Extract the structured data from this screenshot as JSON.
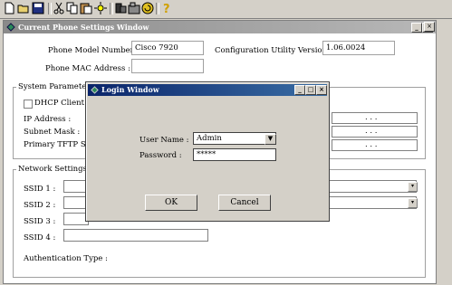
{
  "toolbar": {
    "icons": [
      "new-icon",
      "open-icon",
      "save-icon",
      "cut-icon",
      "copy-icon",
      "paste-icon",
      "settings-icon",
      "phone-icon",
      "folder-icon",
      "refresh-icon",
      "help-icon"
    ]
  },
  "main_window": {
    "title": "Current Phone Settings Window",
    "phone_model_label": "Phone Model Number :",
    "phone_model_value": "Cisco 7920",
    "config_version_label": "Configuration Utility Version :",
    "config_version_value": "1.06.0024",
    "mac_label": "Phone MAC Address :",
    "mac_value": "",
    "system_parameters": {
      "title": "System Parameters",
      "dhcp_label": "DHCP Client",
      "ip_label": "IP Address :",
      "subnet_label": "Subnet Mask :",
      "tftp_label": "Primary TFTP Serv",
      "ip_dots": ".       .       .",
      "subnet_dots": ".       .       .",
      "tftp_dots": ".       .       ."
    },
    "network_settings": {
      "title": "Network Settings",
      "ssid1_label": "SSID 1 :",
      "ssid2_label": "SSID 2 :",
      "ssid3_label": "SSID 3 :",
      "ssid4_label": "SSID 4 :",
      "auth_label": "Authentication Type :"
    }
  },
  "login_dialog": {
    "title": "Login Window",
    "username_label": "User Name :",
    "username_value": "Admin",
    "password_label": "Password :",
    "password_value": "*****",
    "ok_label": "OK",
    "cancel_label": "Cancel"
  },
  "caption_buttons": {
    "minimize": "_",
    "maximize": "□",
    "close": "×"
  },
  "colors": {
    "dialog_title": "#0a246a",
    "window_title_inactive": "#8a8a8a",
    "face": "#d4d0c8"
  }
}
